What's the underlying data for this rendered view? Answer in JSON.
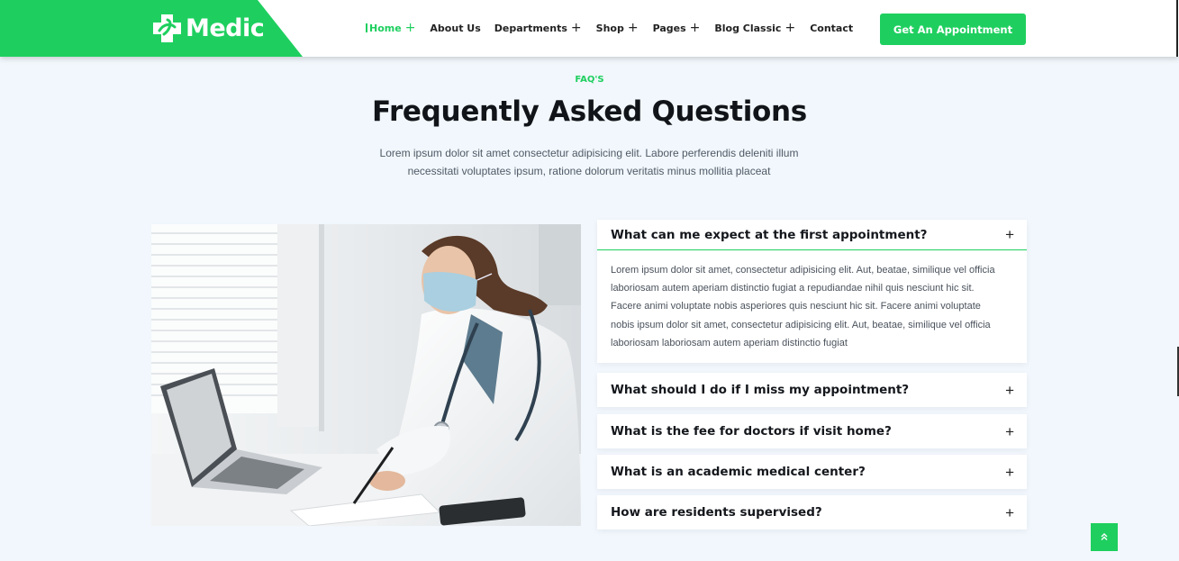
{
  "brand": {
    "name": "Medic"
  },
  "nav": {
    "items": [
      {
        "label": "Home",
        "plus": "+"
      },
      {
        "label": "About Us",
        "plus": ""
      },
      {
        "label": "Departments",
        "plus": "+"
      },
      {
        "label": "Shop",
        "plus": "+"
      },
      {
        "label": "Pages",
        "plus": "+"
      },
      {
        "label": "Blog Classic",
        "plus": "+"
      },
      {
        "label": "Contact",
        "plus": ""
      }
    ],
    "cta": "Get An Appointment"
  },
  "section": {
    "eyebrow": "FAQ'S",
    "title": "Frequently Asked Questions",
    "intro_line1": "Lorem ipsum dolor sit amet consectetur adipisicing elit. Labore perferendis deleniti illum",
    "intro_line2": "necessitati voluptates ipsum, ratione dolorum veritatis minus mollitia placeat"
  },
  "faq": [
    {
      "question": "What can me expect at the first appointment?",
      "icon": "+",
      "answer": "Lorem ipsum dolor sit amet, consectetur adipisicing elit. Aut, beatae, similique vel officia laboriosam autem aperiam distinctio fugiat a repudiandae nihil quis nesciunt hic sit. Facere animi voluptate nobis asperiores quis nesciunt hic sit. Facere animi voluptate nobis ipsum dolor sit amet, consectetur adipisicing elit. Aut, beatae, similique vel officia laboriosam laboriosam autem aperiam distinctio fugiat"
    },
    {
      "question": "What should I do if I miss my appointment?",
      "icon": "+"
    },
    {
      "question": "What is the fee for doctors if visit home?",
      "icon": "+"
    },
    {
      "question": "What is an academic medical center?",
      "icon": "+"
    },
    {
      "question": "How are residents supervised?",
      "icon": "+"
    }
  ],
  "colors": {
    "accent": "#1ecf5f",
    "background": "#f1f7fc",
    "heading": "#111419"
  },
  "icons": {
    "logo": "medical-cross-icon",
    "scroll_top": "double-chevron-up-icon"
  }
}
